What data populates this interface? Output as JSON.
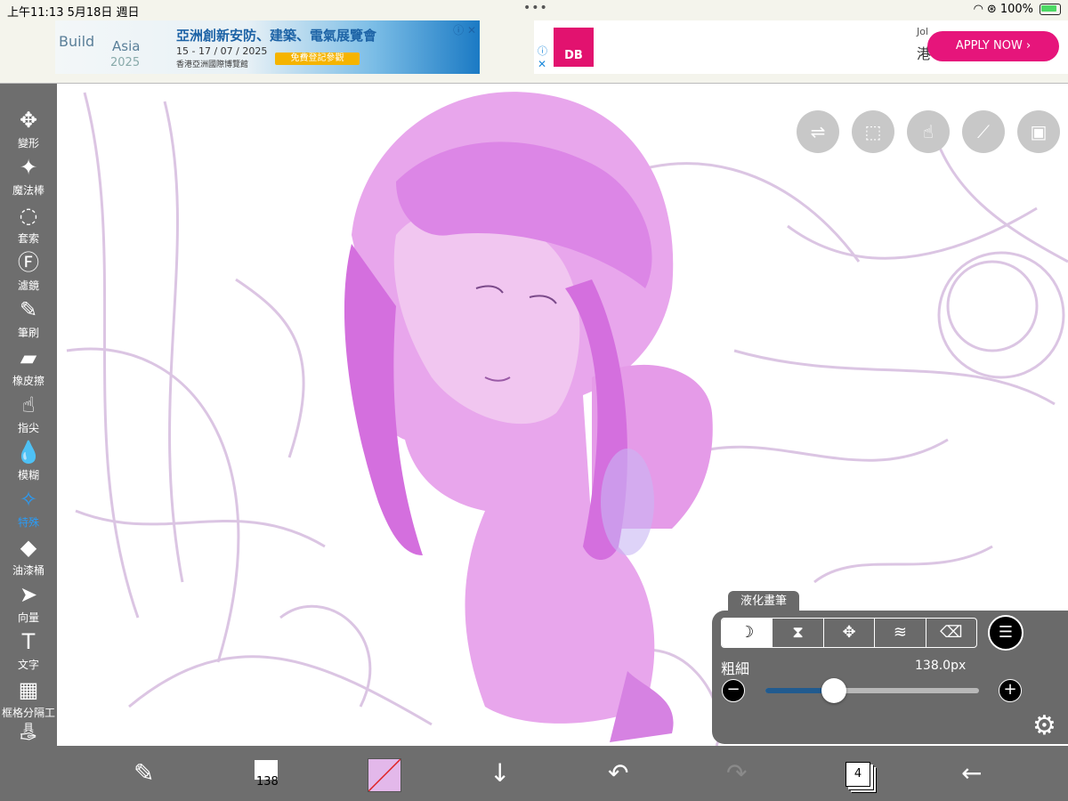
{
  "status_bar": {
    "time_date": "上午11:13  5月18日 週日",
    "battery": "100%"
  },
  "ads": {
    "left": {
      "logo_line1": "Build",
      "logo_line2": "Asia",
      "logo_year": "2025",
      "title": "亞洲創新安防、建築、電氣展覽會",
      "dates": "15 - 17 / 07 / 2025",
      "venue": "香港亞洲國際博覽館",
      "cta": "免費登記參觀"
    },
    "right": {
      "brand": "DB",
      "partial_text_1": "Jol",
      "partial_text_2": "港",
      "cta": "APPLY NOW ›"
    }
  },
  "tools": [
    {
      "id": "transform",
      "label": "變形",
      "icon": "move-icon"
    },
    {
      "id": "magic-wand",
      "label": "魔法棒",
      "icon": "magic-wand-icon"
    },
    {
      "id": "lasso",
      "label": "套索",
      "icon": "lasso-icon"
    },
    {
      "id": "filter",
      "label": "濾鏡",
      "icon": "fx-icon"
    },
    {
      "id": "brush",
      "label": "筆刷",
      "icon": "brush-icon"
    },
    {
      "id": "eraser",
      "label": "橡皮擦",
      "icon": "eraser-icon"
    },
    {
      "id": "smudge",
      "label": "指尖",
      "icon": "finger-icon"
    },
    {
      "id": "blur",
      "label": "模糊",
      "icon": "drop-icon"
    },
    {
      "id": "special",
      "label": "特殊",
      "icon": "special-brush-icon",
      "active": true
    },
    {
      "id": "bucket",
      "label": "油漆桶",
      "icon": "bucket-icon"
    },
    {
      "id": "vector",
      "label": "向量",
      "icon": "cursor-icon"
    },
    {
      "id": "text",
      "label": "文字",
      "icon": "text-icon"
    },
    {
      "id": "frame",
      "label": "框格分隔工具",
      "icon": "frame-divider-icon"
    },
    {
      "id": "eyedropper",
      "label": "滴管",
      "icon": "eyedropper-icon"
    }
  ],
  "liquify_panel": {
    "tab_label": "液化畫筆",
    "size_label": "粗細",
    "size_value": "138.0px",
    "slider_fraction": 0.32
  },
  "bottom_bar": {
    "brush_size": "138",
    "color": "#e3b8ea",
    "layer_count": "4"
  }
}
